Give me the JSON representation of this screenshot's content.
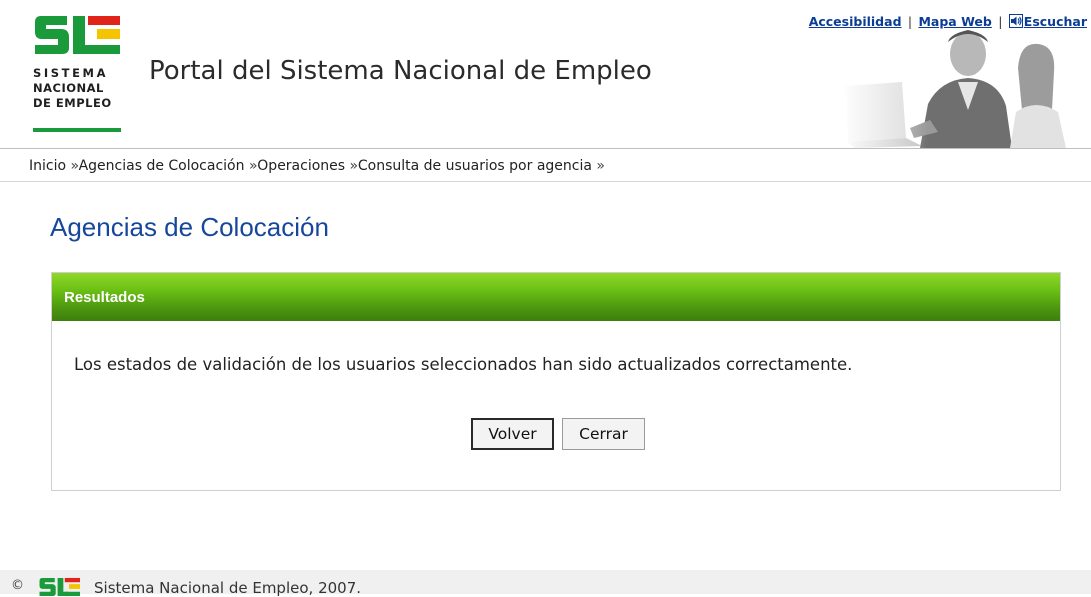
{
  "header": {
    "logo_lines": [
      "SISTEMA",
      "NACIONAL",
      "DE EMPLEO"
    ],
    "site_title": "Portal del Sistema Nacional de Empleo",
    "links": {
      "accesibilidad": "Accesibilidad",
      "mapa_web": "Mapa Web",
      "escuchar": "Escuchar",
      "separator": "|"
    }
  },
  "breadcrumb": [
    {
      "label": "Inicio"
    },
    {
      "label": "Agencias de Colocación"
    },
    {
      "label": "Operaciones"
    },
    {
      "label": "Consulta de usuarios por agencia"
    }
  ],
  "breadcrumb_separator": "»",
  "page": {
    "title": "Agencias de Colocación",
    "panel_title": "Resultados",
    "message": "Los estados de validación de los usuarios seleccionados han sido actualizados correctamente.",
    "buttons": {
      "volver": "Volver",
      "cerrar": "Cerrar"
    }
  },
  "footer": {
    "copyright_symbol": "©",
    "text": "Sistema Nacional de Empleo, 2007."
  },
  "colors": {
    "brand_green": "#1a9a3a",
    "brand_red": "#e2231a",
    "brand_yellow": "#f5c400",
    "link_blue": "#0b3c96",
    "title_blue": "#17479c",
    "panel_green": "#4e9a10"
  }
}
